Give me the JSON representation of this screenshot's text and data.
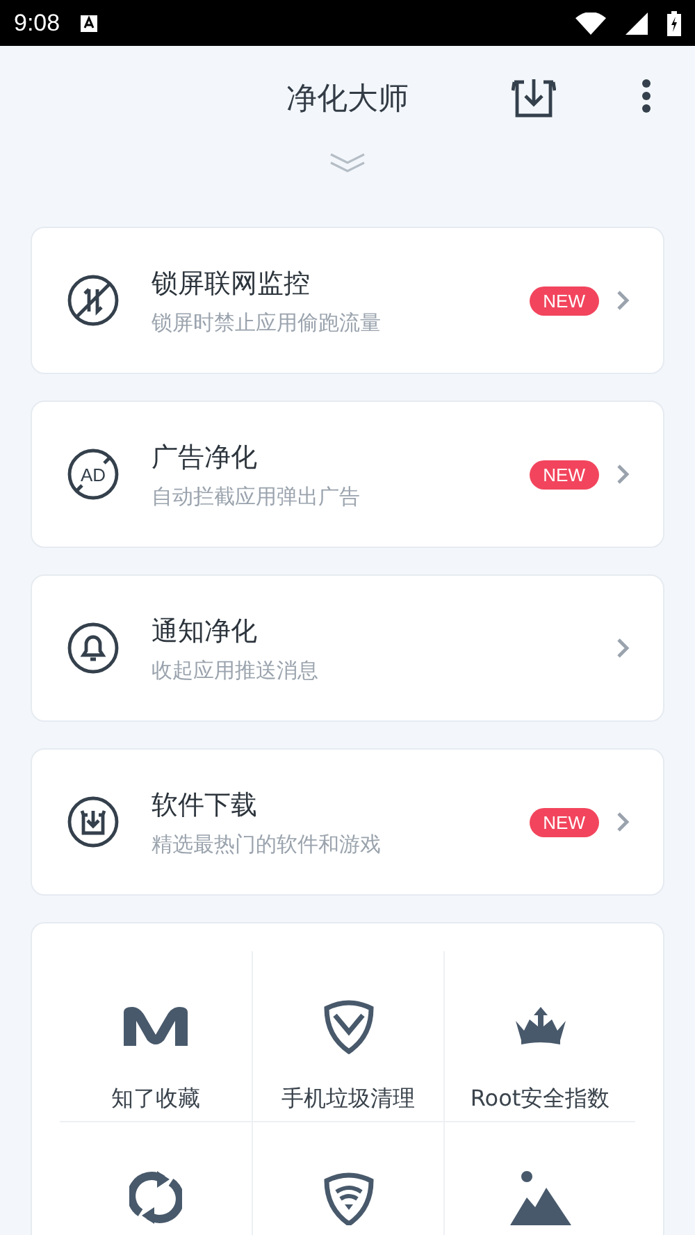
{
  "status_bar": {
    "time": "9:08"
  },
  "header": {
    "title": "净化大师"
  },
  "features": [
    {
      "kind": "data",
      "title": "锁屏联网监控",
      "subtitle": "锁屏时禁止应用偷跑流量",
      "badge": "NEW"
    },
    {
      "kind": "ad",
      "title": "广告净化",
      "subtitle": "自动拦截应用弹出广告",
      "badge": "NEW",
      "ad_text": "AD"
    },
    {
      "kind": "bell",
      "title": "通知净化",
      "subtitle": "收起应用推送消息"
    },
    {
      "kind": "download",
      "title": "软件下载",
      "subtitle": "精选最热门的软件和游戏",
      "badge": "NEW"
    }
  ],
  "tools": [
    {
      "kind": "m",
      "label": "知了收藏"
    },
    {
      "kind": "shield",
      "label": "手机垃圾清理"
    },
    {
      "kind": "crown",
      "label": "Root安全指数"
    },
    {
      "kind": "refresh"
    },
    {
      "kind": "wifi-shield"
    },
    {
      "kind": "mountain"
    }
  ]
}
